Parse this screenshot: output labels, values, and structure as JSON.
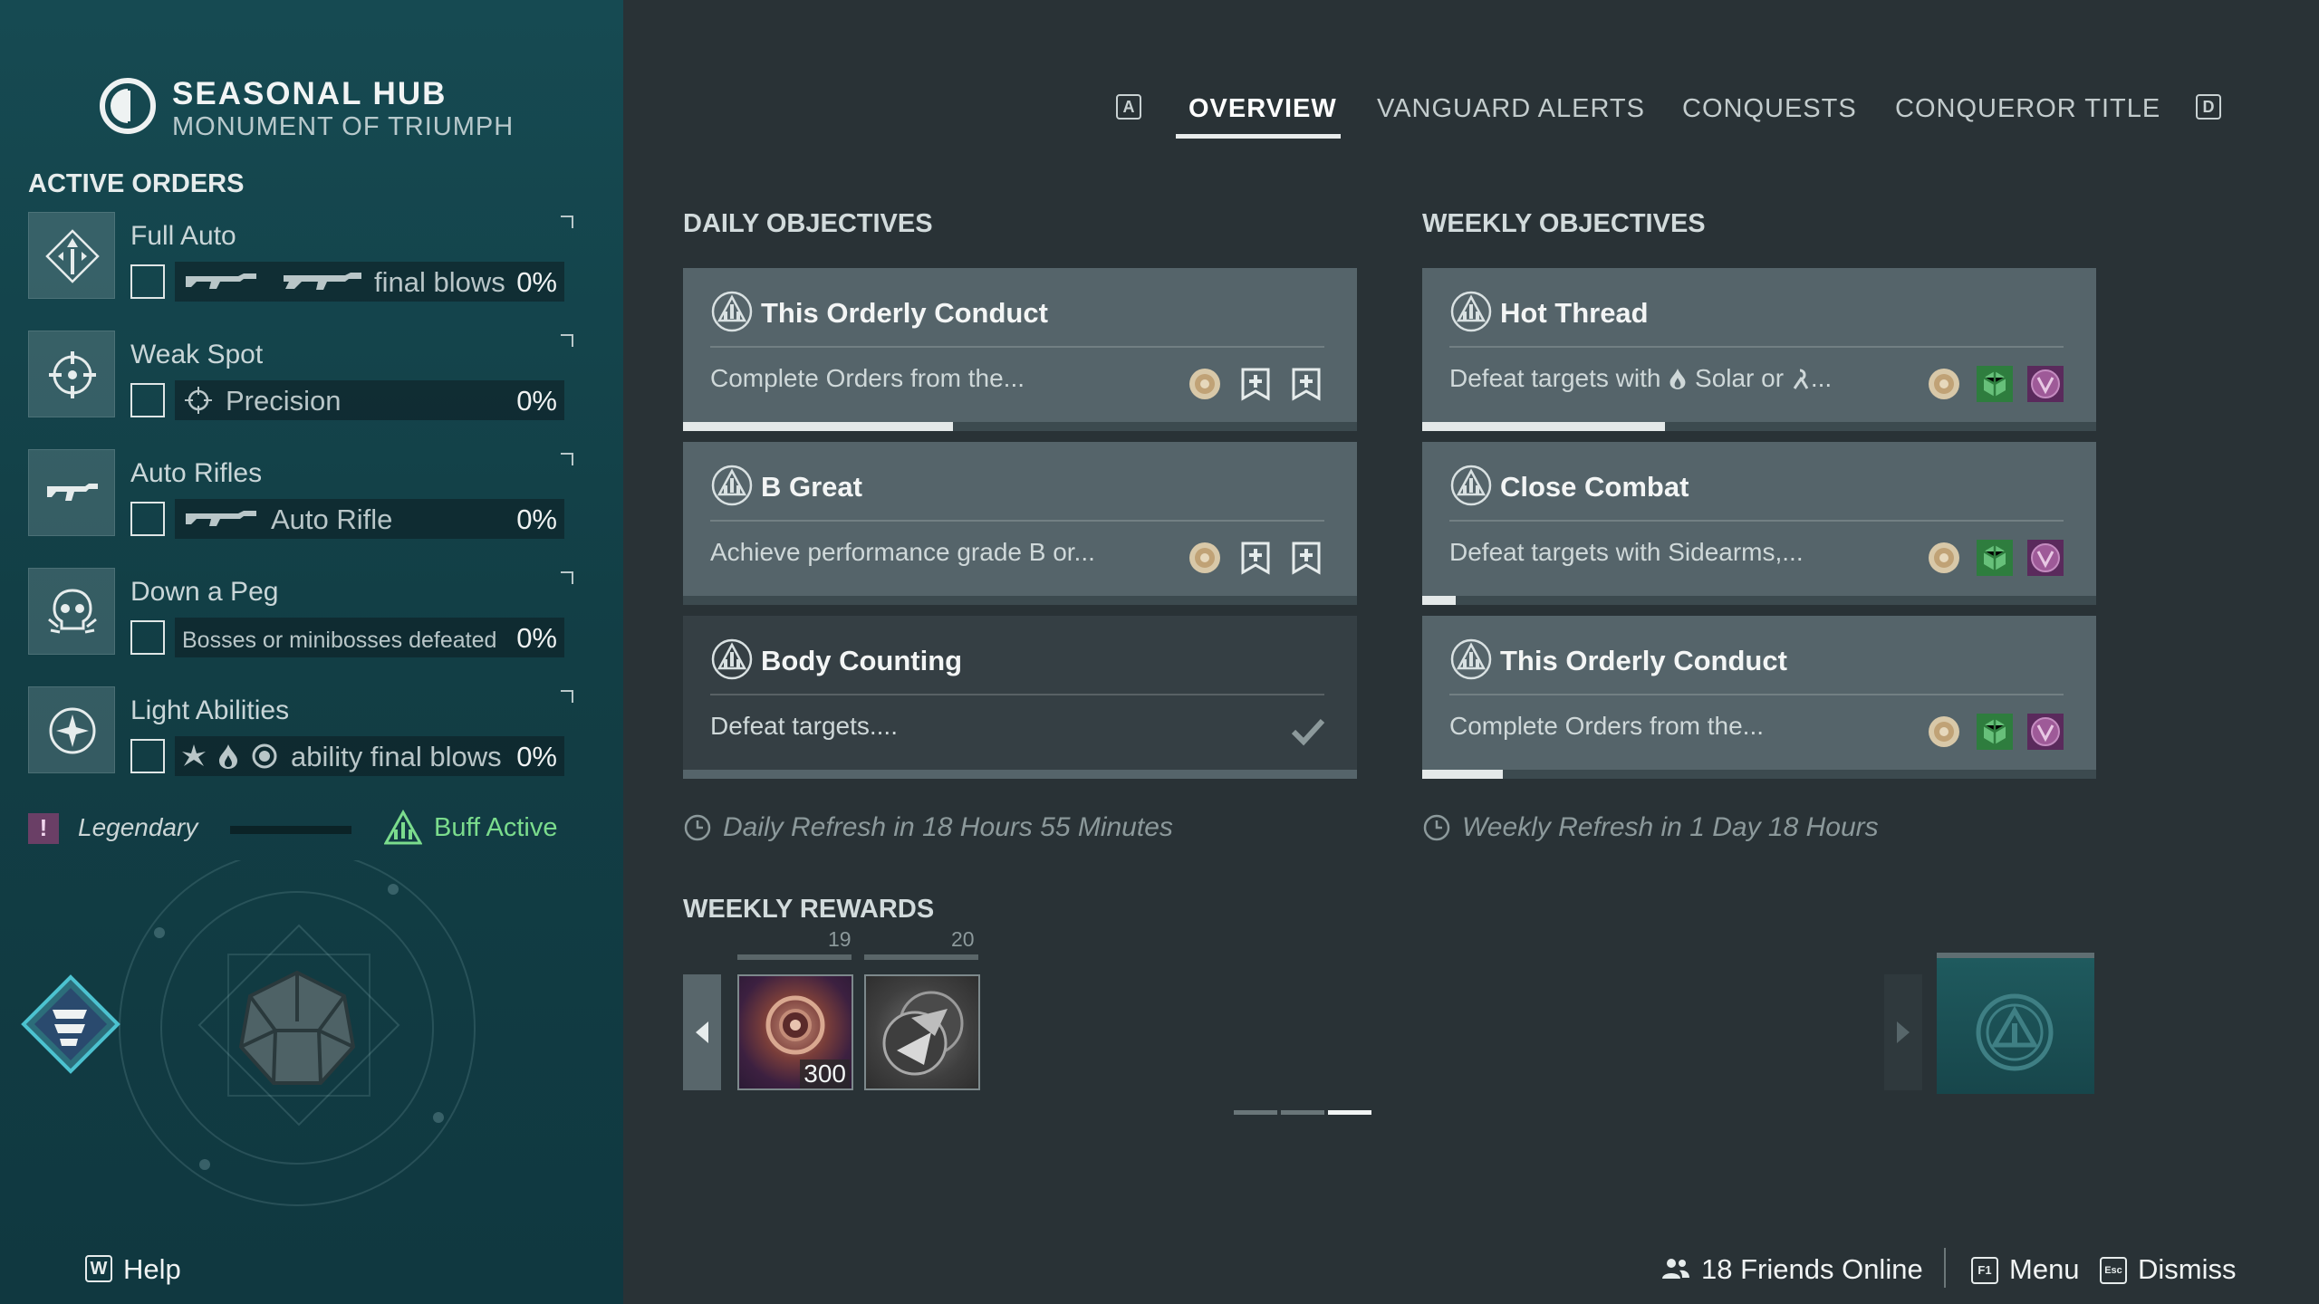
{
  "header": {
    "title": "SEASONAL HUB",
    "subtitle": "MONUMENT OF TRIUMPH"
  },
  "sidebar": {
    "heading": "ACTIVE ORDERS",
    "orders": [
      {
        "name": "Full Auto",
        "objective": "final blows",
        "progress": "0%",
        "icons": [
          "auto-rifle-icon",
          "machine-gun-icon"
        ]
      },
      {
        "name": "Weak Spot",
        "objective": "Precision",
        "progress": "0%",
        "icons": [
          "precision-icon"
        ]
      },
      {
        "name": "Auto Rifles",
        "objective": "Auto Rifle",
        "progress": "0%",
        "icons": [
          "auto-rifle-icon"
        ]
      },
      {
        "name": "Down a Peg",
        "objective": "Bosses or minibosses defeated",
        "progress": "0%",
        "icons": []
      },
      {
        "name": "Light Abilities",
        "objective": "ability final blows",
        "progress": "0%",
        "icons": [
          "arc-icon",
          "solar-icon",
          "void-icon"
        ]
      }
    ],
    "legendary_label": "Legendary",
    "legendary_badge": "!",
    "buff_label": "Buff Active"
  },
  "tabs": {
    "left_key": "A",
    "right_key": "D",
    "items": [
      "OVERVIEW",
      "VANGUARD ALERTS",
      "CONQUESTS",
      "CONQUEROR TITLE"
    ],
    "active": "OVERVIEW"
  },
  "daily": {
    "heading": "DAILY OBJECTIVES",
    "cards": [
      {
        "title": "This Orderly Conduct",
        "desc": "Complete Orders from the...",
        "progress": 0.4,
        "completed": false
      },
      {
        "title": "B Great",
        "desc": "Achieve performance grade B or...",
        "progress": 0.0,
        "completed": false
      },
      {
        "title": "Body Counting",
        "desc": "Defeat targets....",
        "progress": 1.0,
        "completed": true
      }
    ],
    "refresh": "Daily Refresh in 18 Hours 55 Minutes"
  },
  "weekly": {
    "heading": "WEEKLY OBJECTIVES",
    "cards": [
      {
        "title": "Hot Thread",
        "desc_prefix": "Defeat targets with",
        "desc_mid": "Solar or",
        "desc_suffix": "...",
        "progress": 0.36
      },
      {
        "title": "Close Combat",
        "desc": "Defeat targets with Sidearms,...",
        "progress": 0.05
      },
      {
        "title": "This Orderly Conduct",
        "desc": "Complete Orders from the...",
        "progress": 0.12
      }
    ],
    "refresh": "Weekly Refresh in 1 Day 18 Hours"
  },
  "rewards": {
    "heading": "WEEKLY REWARDS",
    "tiers": [
      {
        "rank": "19",
        "quantity": "300"
      },
      {
        "rank": "20",
        "quantity": ""
      }
    ],
    "page": 3,
    "pages": 3
  },
  "footer": {
    "help_key": "W",
    "help_label": "Help",
    "friends_label": "18 Friends Online",
    "menu_key": "F1",
    "menu_label": "Menu",
    "dismiss_key": "Esc",
    "dismiss_label": "Dismiss"
  },
  "colors": {
    "sidebar": "#164a52",
    "background": "#293236",
    "card": "#55646a",
    "card_completed": "#353f44",
    "buff": "#7bdc8d",
    "legendary": "#6a3f66"
  }
}
